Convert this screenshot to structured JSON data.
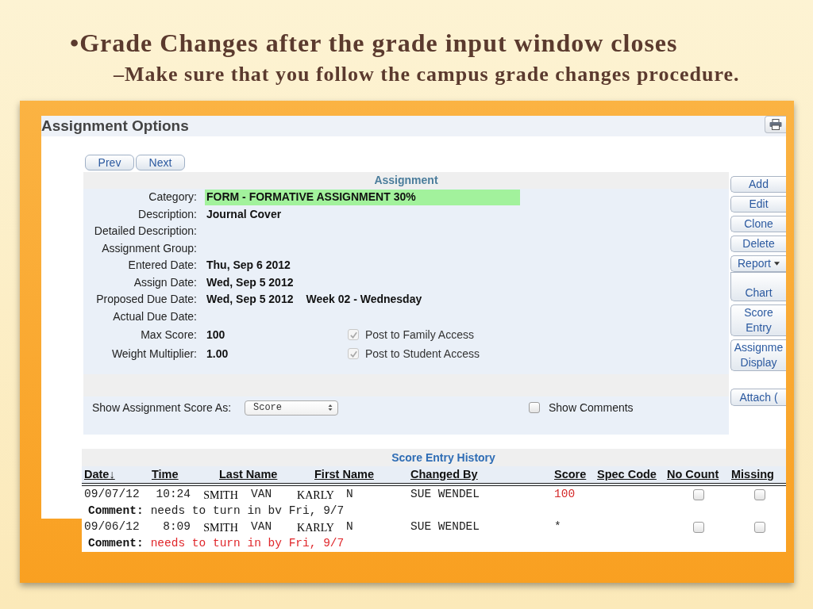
{
  "slide": {
    "title": "•Grade Changes after the grade input window closes",
    "subtitle": "–Make sure that you follow the campus grade changes procedure."
  },
  "window": {
    "title": "Assignment Options"
  },
  "nav_buttons": [
    "Prev",
    "Next"
  ],
  "assignment": {
    "heading": "Assignment",
    "fields": [
      {
        "label": "Category:",
        "value": "FORM - FORMATIVE ASSIGNMENT 30%",
        "highlighted": true
      },
      {
        "label": "Description:",
        "value": "Journal Cover",
        "highlighted": false
      },
      {
        "label": "Detailed Description:",
        "highlighted": false
      },
      {
        "label": "Assignment Group:",
        "highlighted": false
      },
      {
        "label": "Entered Date:",
        "value": "Thu, Sep 6 2012",
        "highlighted": false
      },
      {
        "label": "Assign Date:",
        "value": "Wed, Sep 5 2012",
        "highlighted": false
      },
      {
        "label": "Proposed Due Date:",
        "value": "Wed, Sep 5 2012",
        "note": "Week 02 - Wednesday",
        "highlighted": false
      },
      {
        "label": "Actual Due Date:",
        "highlighted": false
      },
      {
        "label": "Max Score:",
        "value": "100",
        "highlighted": false,
        "option": {
          "label": "Post to Family Access",
          "checked": true,
          "disabled": true
        }
      },
      {
        "label": "Weight Multiplier:",
        "value": "1.00",
        "highlighted": false,
        "option": {
          "label": "Post to Student Access",
          "checked": true,
          "disabled": true
        }
      }
    ],
    "score_display": {
      "label": "Show Assignment Score As:",
      "value": "Score"
    },
    "show_comments": {
      "label": "Show Comments",
      "checked": false
    }
  },
  "side_buttons": [
    {
      "lines": [
        "Add"
      ],
      "kind": "plain"
    },
    {
      "lines": [
        "Edit"
      ],
      "kind": "plain"
    },
    {
      "lines": [
        "Clone"
      ],
      "kind": "plain"
    },
    {
      "lines": [
        "Delete"
      ],
      "kind": "plain"
    },
    {
      "lines": [
        "Report"
      ],
      "kind": "menu"
    },
    {
      "lines": [
        "Chart"
      ],
      "kind": "tall"
    },
    {
      "lines": [
        "Score",
        "Entry"
      ],
      "kind": "plain"
    },
    {
      "lines": [
        "Assignme",
        "Display"
      ],
      "kind": "plain"
    },
    {
      "lines": [
        "Attach ("
      ],
      "kind": "detached"
    }
  ],
  "history": {
    "title": "Score Entry History",
    "columns": [
      "Date↓",
      "Time",
      "Last Name",
      "First Name",
      "Changed By",
      "Score",
      "Spec Code",
      "No Count",
      "Missing"
    ],
    "rows": [
      {
        "date": "09/07/12",
        "time": "10:24",
        "last_name": {
          "label": "SMITH",
          "shown": "VAN"
        },
        "first_name": {
          "label": "KARLY",
          "shown": "N"
        },
        "changed_by": "SUE WENDEL",
        "score": "100",
        "score_changed": true,
        "no_count": false,
        "missing": false,
        "comment_label": "Comment:",
        "comment": "needs to turn in bv Fri, 9/7",
        "comment_changed": false
      },
      {
        "date": "09/06/12",
        "time": "8:09",
        "last_name": {
          "label": "SMITH",
          "shown": "VAN"
        },
        "first_name": {
          "label": "KARLY",
          "shown": "N"
        },
        "changed_by": "SUE WENDEL",
        "score": "*",
        "score_changed": false,
        "no_count": false,
        "missing": false,
        "comment_label": "Comment:",
        "comment": "needs to turn in by Fri, 9/7",
        "comment_changed": true
      }
    ]
  }
}
